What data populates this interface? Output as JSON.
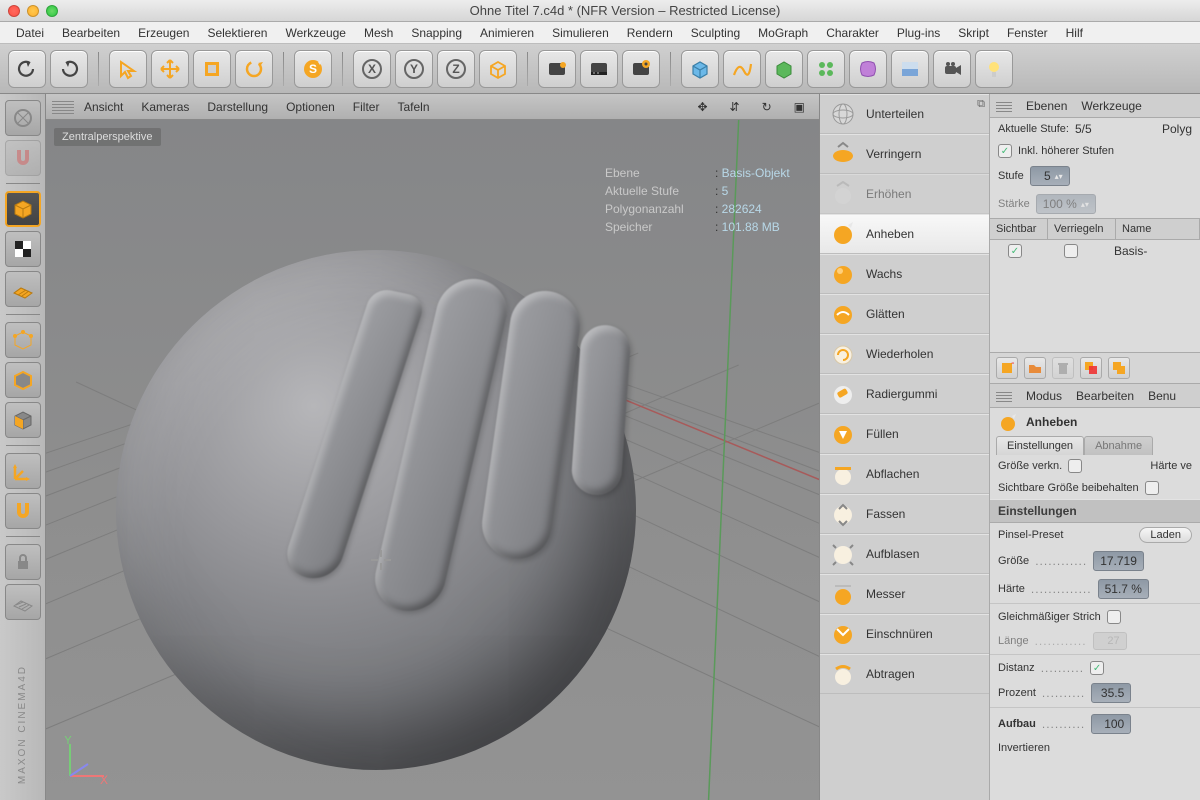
{
  "window": {
    "title": "Ohne Titel 7.c4d * (NFR Version – Restricted License)"
  },
  "menu": [
    "Datei",
    "Bearbeiten",
    "Erzeugen",
    "Selektieren",
    "Werkzeuge",
    "Mesh",
    "Snapping",
    "Animieren",
    "Simulieren",
    "Rendern",
    "Sculpting",
    "MoGraph",
    "Charakter",
    "Plug-ins",
    "Skript",
    "Fenster",
    "Hilf"
  ],
  "viewportMenu": [
    "Ansicht",
    "Kameras",
    "Darstellung",
    "Optionen",
    "Filter",
    "Tafeln"
  ],
  "viewportLabel": "Zentralperspektive",
  "hud": {
    "k1": "Ebene",
    "v1": "Basis-Objekt",
    "k2": "Aktuelle Stufe",
    "v2": "5",
    "k3": "Polygonanzahl",
    "v3": "282624",
    "k4": "Speicher",
    "v4": "101.88 MB"
  },
  "sculptTools": [
    {
      "label": "Unterteilen",
      "icon": "globe",
      "faint": false,
      "sel": false,
      "pop": true
    },
    {
      "label": "Verringern",
      "icon": "squash",
      "faint": false,
      "sel": false
    },
    {
      "label": "Erhöhen",
      "icon": "expand",
      "faint": true,
      "sel": false
    },
    {
      "label": "Anheben",
      "icon": "pull",
      "faint": false,
      "sel": true
    },
    {
      "label": "Wachs",
      "icon": "wax",
      "faint": false,
      "sel": false
    },
    {
      "label": "Glätten",
      "icon": "smooth",
      "faint": false,
      "sel": false
    },
    {
      "label": "Wiederholen",
      "icon": "repeat",
      "faint": false,
      "sel": false
    },
    {
      "label": "Radiergummi",
      "icon": "eraser",
      "faint": false,
      "sel": false
    },
    {
      "label": "Füllen",
      "icon": "fill",
      "faint": false,
      "sel": false
    },
    {
      "label": "Abflachen",
      "icon": "flatten",
      "faint": false,
      "sel": false
    },
    {
      "label": "Fassen",
      "icon": "grab",
      "faint": false,
      "sel": false
    },
    {
      "label": "Aufblasen",
      "icon": "inflate",
      "faint": false,
      "sel": false
    },
    {
      "label": "Messer",
      "icon": "knife",
      "faint": false,
      "sel": false
    },
    {
      "label": "Einschnüren",
      "icon": "pinch",
      "faint": false,
      "sel": false
    },
    {
      "label": "Abtragen",
      "icon": "scrape",
      "faint": false,
      "sel": false
    }
  ],
  "layers": {
    "tabs": [
      "Ebenen",
      "Werkzeuge"
    ],
    "stufeLabel": "Aktuelle Stufe:",
    "stufeValue": "5/5",
    "polyLabel": "Polyg",
    "inklLabel": "Inkl. höherer Stufen",
    "stufeFieldLabel": "Stufe",
    "stufeField": "5",
    "staerkeLabel": "Stärke",
    "staerkeField": "100 %",
    "cols": [
      "Sichtbar",
      "Verriegeln",
      "Name"
    ],
    "row": {
      "name": "Basis-"
    }
  },
  "attr": {
    "tabs": [
      "Modus",
      "Bearbeiten",
      "Benu"
    ],
    "toolName": "Anheben",
    "subtabs": [
      "Einstellungen",
      "Abnahme"
    ],
    "groesseVerkn": "Größe verkn.",
    "haerteVe": "Härte ve",
    "sichtbareGroesse": "Sichtbare Größe beibehalten",
    "einstellungenHdr": "Einstellungen",
    "pinselPreset": "Pinsel-Preset",
    "laden": "Laden",
    "groesse": "Größe",
    "groesseVal": "17.719",
    "haerte": "Härte",
    "haerteVal": "51.7 %",
    "gleich": "Gleichmäßiger Strich",
    "laenge": "Länge",
    "laengeVal": "27",
    "distanz": "Distanz",
    "prozent": "Prozent",
    "prozentVal": "35.5",
    "aufbau": "Aufbau",
    "aufbauVal": "100",
    "invert": "Invertieren"
  },
  "brand": "MAXON CINEMA4D"
}
